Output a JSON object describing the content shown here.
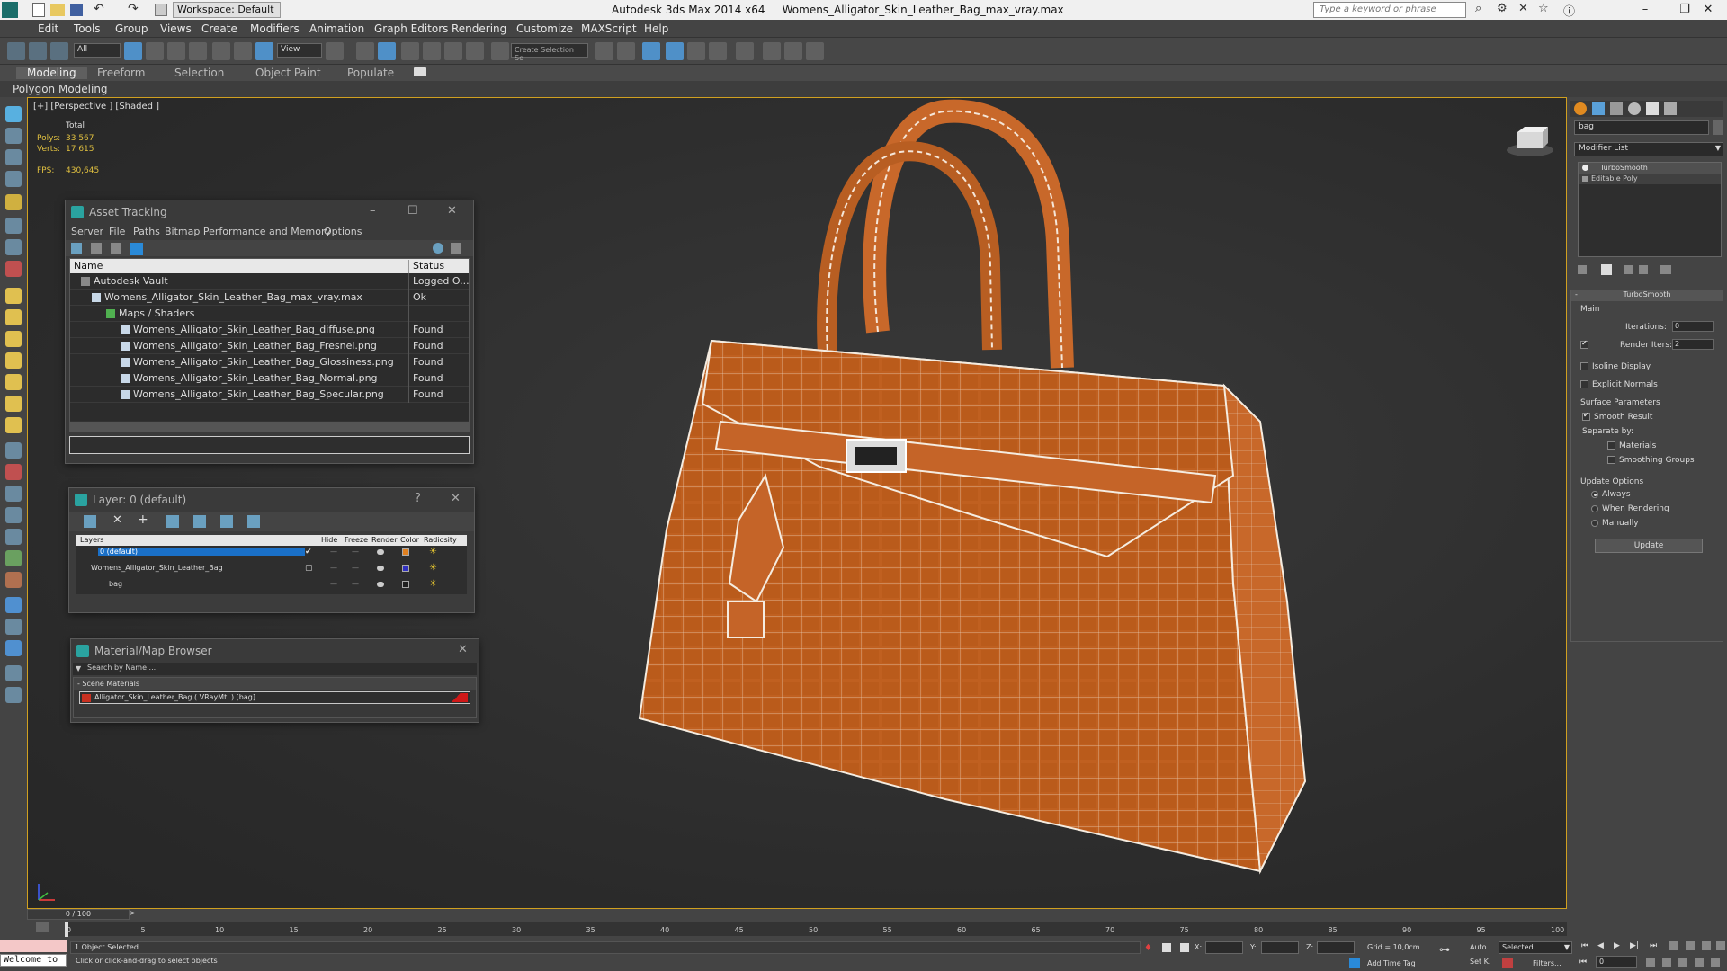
{
  "titlebar": {
    "workspace": "Workspace: Default",
    "app_title": "Autodesk 3ds Max  2014 x64",
    "file_title": "Womens_Alligator_Skin_Leather_Bag_max_vray.max",
    "search_placeholder": "Type a keyword or phrase"
  },
  "menu": {
    "edit": "Edit",
    "tools": "Tools",
    "group": "Group",
    "views": "Views",
    "create": "Create",
    "modifiers": "Modifiers",
    "animation": "Animation",
    "graph_editors": "Graph Editors",
    "rendering": "Rendering",
    "customize": "Customize",
    "maxscript": "MAXScript",
    "help": "Help"
  },
  "toolbar": {
    "filter": "All",
    "ref_coord": "View",
    "selection_set": "Create Selection Se"
  },
  "ribbon": {
    "modeling": "Modeling",
    "freeform": "Freeform",
    "selection": "Selection",
    "object_paint": "Object Paint",
    "populate": "Populate",
    "polygon_modeling": "Polygon Modeling"
  },
  "viewport": {
    "label": "[+] [Perspective ] [Shaded ]",
    "total": "Total",
    "polys_label": "Polys:",
    "polys_value": "33 567",
    "verts_label": "Verts:",
    "verts_value": "17 615",
    "fps_label": "FPS:",
    "fps_value": "430,645"
  },
  "asset_tracking": {
    "title": "Asset Tracking",
    "menu": [
      "Server",
      "File",
      "Paths",
      "Bitmap Performance and Memory",
      "Options"
    ],
    "col_name": "Name",
    "col_status": "Status",
    "rows": [
      {
        "name": "Autodesk Vault",
        "status": "Logged O..."
      },
      {
        "name": "Womens_Alligator_Skin_Leather_Bag_max_vray.max",
        "status": "Ok"
      },
      {
        "name": "Maps / Shaders",
        "status": ""
      },
      {
        "name": "Womens_Alligator_Skin_Leather_Bag_diffuse.png",
        "status": "Found"
      },
      {
        "name": "Womens_Alligator_Skin_Leather_Bag_Fresnel.png",
        "status": "Found"
      },
      {
        "name": "Womens_Alligator_Skin_Leather_Bag_Glossiness.png",
        "status": "Found"
      },
      {
        "name": "Womens_Alligator_Skin_Leather_Bag_Normal.png",
        "status": "Found"
      },
      {
        "name": "Womens_Alligator_Skin_Leather_Bag_Specular.png",
        "status": "Found"
      }
    ]
  },
  "layer": {
    "title": "Layer: 0 (default)",
    "help": "?",
    "cols": [
      "Layers",
      "Hide",
      "Freeze",
      "Render",
      "Color",
      "Radiosity"
    ],
    "rows": [
      {
        "name": "0 (default)",
        "color": "#e08020"
      },
      {
        "name": "Womens_Alligator_Skin_Leather_Bag",
        "color": "#3030c0"
      },
      {
        "name": "bag",
        "color": "#202020"
      }
    ]
  },
  "material_browser": {
    "title": "Material/Map Browser",
    "search_placeholder": "Search by Name ...",
    "group": "- Scene Materials",
    "item": "Alligator_Skin_Leather_Bag  ( VRayMtl ) [bag]"
  },
  "command_panel": {
    "object_name": "bag",
    "modifier_list": "Modifier List",
    "stack": [
      "TurboSmooth",
      "Editable Poly"
    ],
    "rollout_title": "TurboSmooth",
    "main": "Main",
    "iterations_label": "Iterations:",
    "iterations_value": "0",
    "render_iters_label": "Render Iters:",
    "render_iters_value": "2",
    "isoline": "Isoline Display",
    "explicit_normals": "Explicit Normals",
    "surface_params": "Surface Parameters",
    "smooth_result": "Smooth Result",
    "separate_by": "Separate by:",
    "materials": "Materials",
    "smoothing_groups": "Smoothing Groups",
    "update_options": "Update Options",
    "always": "Always",
    "when_rendering": "When Rendering",
    "manually": "Manually",
    "update": "Update"
  },
  "timeline": {
    "frame": "0 / 100",
    "ticks": [
      "0",
      "5",
      "10",
      "15",
      "20",
      "25",
      "30",
      "35",
      "40",
      "45",
      "50",
      "55",
      "60",
      "65",
      "70",
      "75",
      "80",
      "85",
      "90",
      "95",
      "100"
    ]
  },
  "status": {
    "maxscript": "Welcome to",
    "selected": "1 Object Selected",
    "prompt": "Click or click-and-drag to select objects",
    "x_label": "X:",
    "y_label": "Y:",
    "z_label": "Z:",
    "grid": "Grid = 10,0cm",
    "add_time_tag": "Add Time Tag",
    "auto": "Auto",
    "setk": "Set K.",
    "key_mode": "Selected",
    "filters": "Filters...",
    "frame_field": "0"
  }
}
